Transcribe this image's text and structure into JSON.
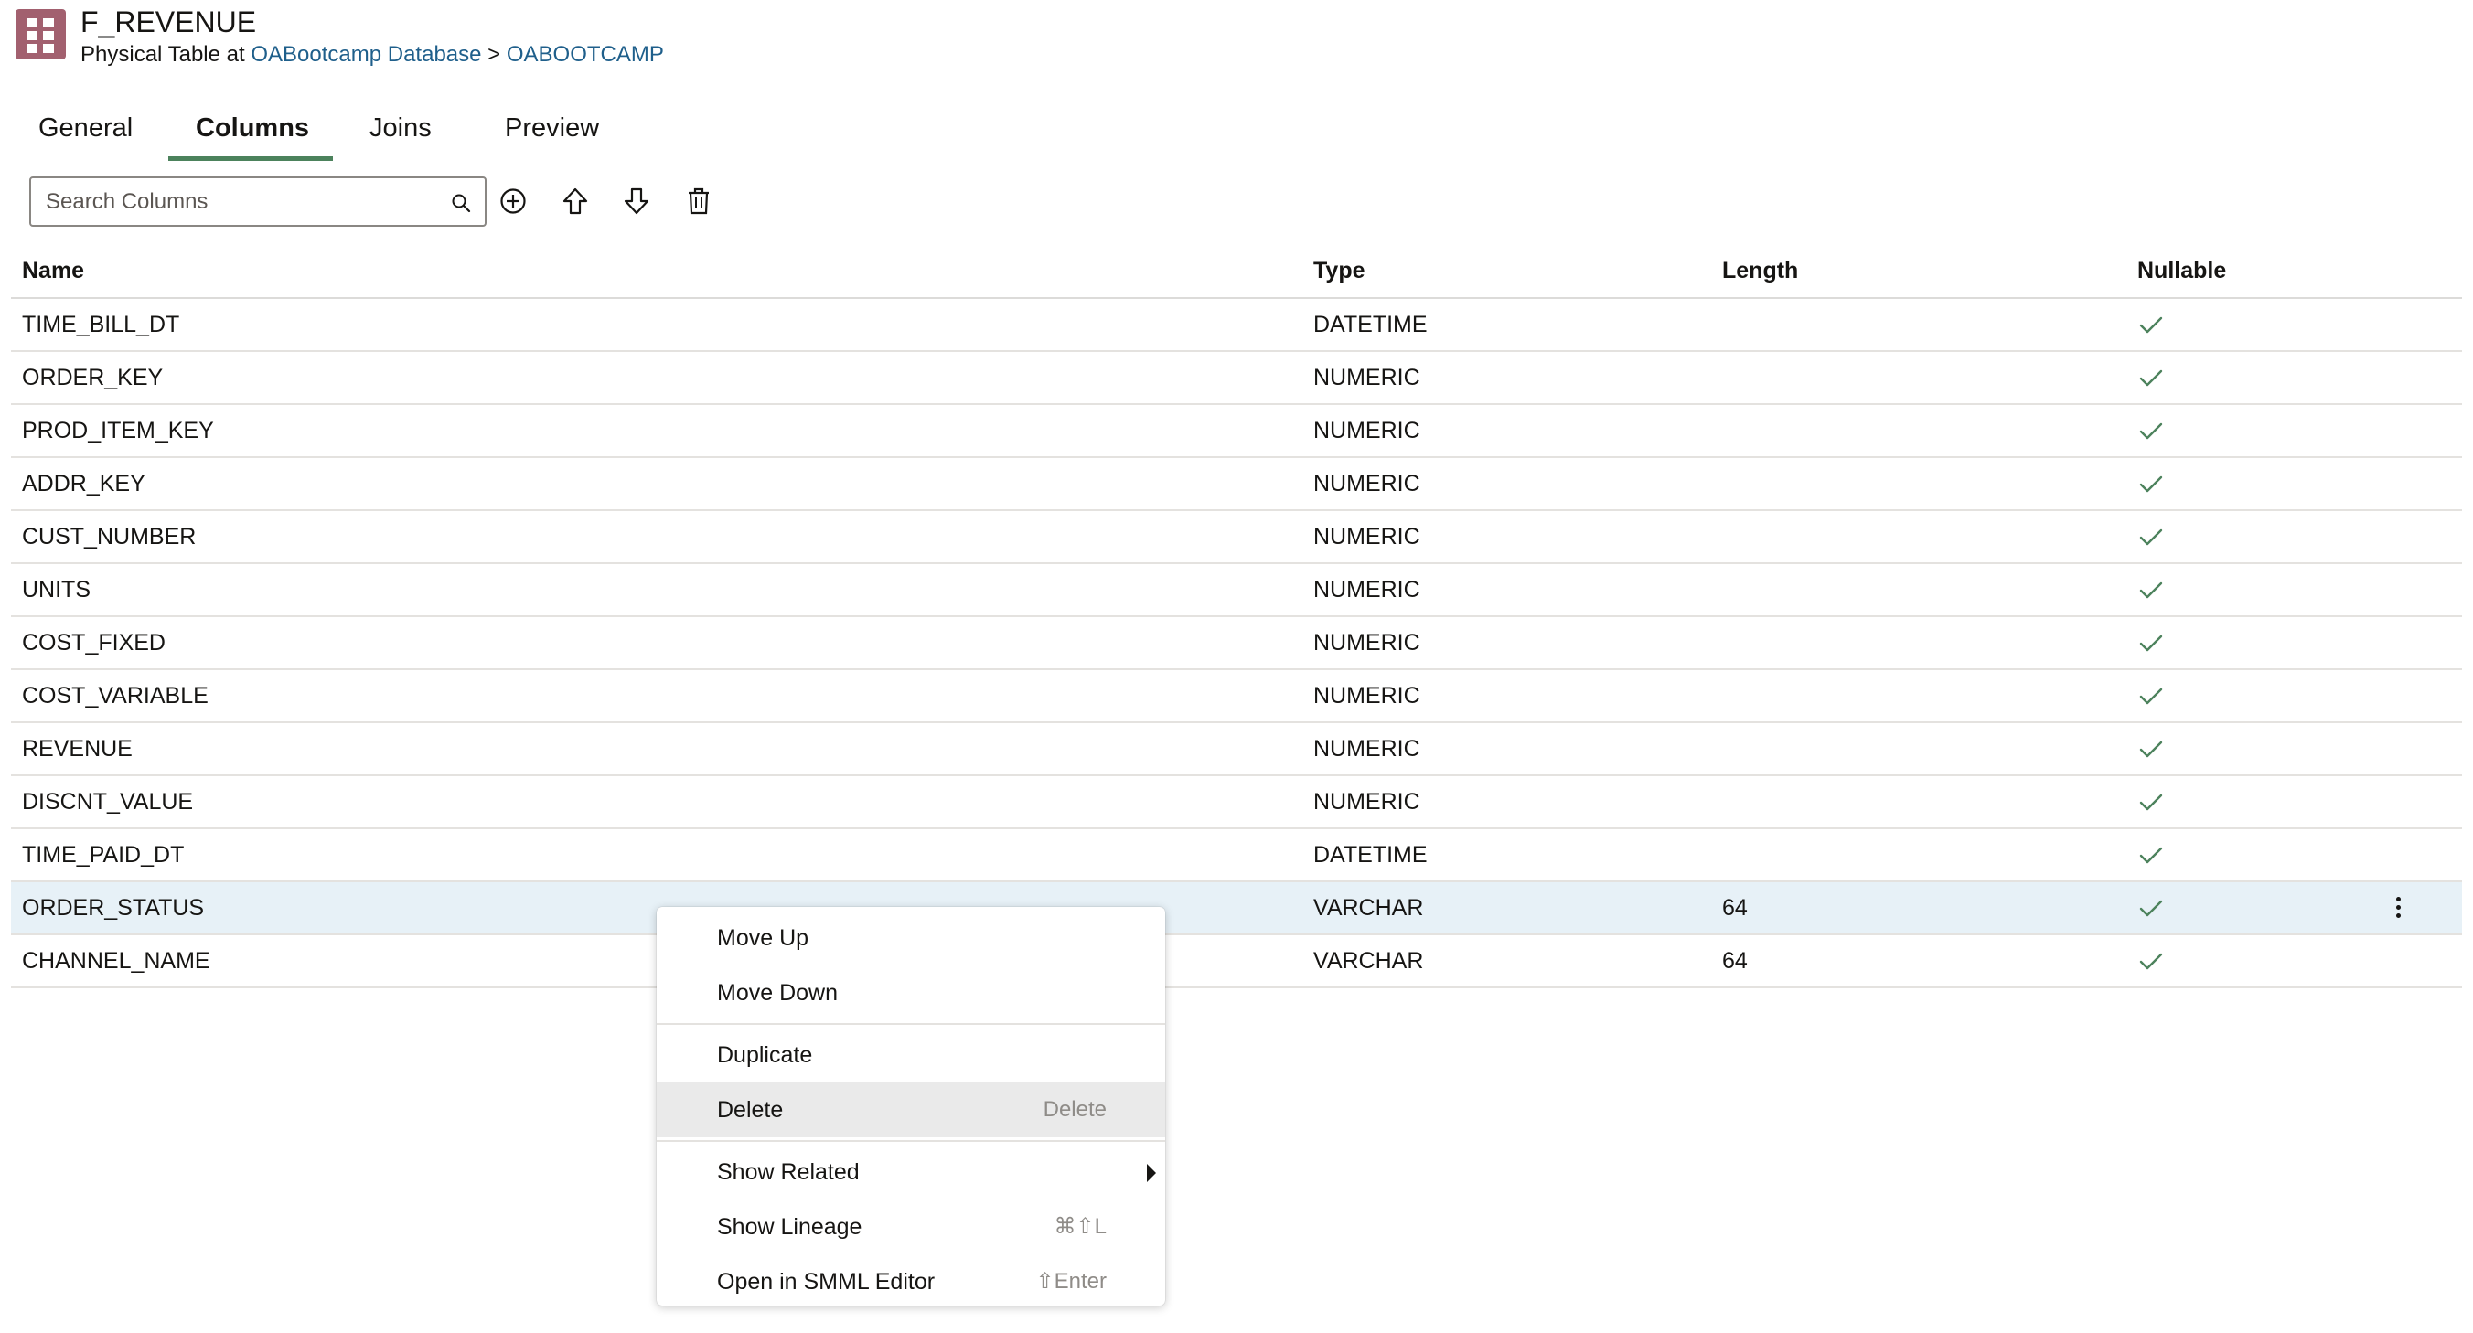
{
  "header": {
    "title": "F_REVENUE",
    "subtitle_prefix": "Physical Table at",
    "database_link": "OABootcamp Database",
    "separator": ">",
    "schema_link": "OABOOTCAMP",
    "icon": "table-grid-icon",
    "icon_color": "#a2606f"
  },
  "tabs": [
    {
      "label": "General"
    },
    {
      "label": "Columns",
      "active": true
    },
    {
      "label": "Joins"
    },
    {
      "label": "Preview"
    }
  ],
  "toolbar": {
    "search_placeholder": "Search Columns",
    "search_value": "",
    "icons": [
      "add-icon",
      "move-up-icon",
      "move-down-icon",
      "delete-icon"
    ]
  },
  "table": {
    "headers": {
      "name": "Name",
      "type": "Type",
      "length": "Length",
      "nullable": "Nullable"
    },
    "rows": [
      {
        "name": "TIME_BILL_DT",
        "type": "DATETIME",
        "length": "",
        "nullable": true
      },
      {
        "name": "ORDER_KEY",
        "type": "NUMERIC",
        "length": "",
        "nullable": true
      },
      {
        "name": "PROD_ITEM_KEY",
        "type": "NUMERIC",
        "length": "",
        "nullable": true
      },
      {
        "name": "ADDR_KEY",
        "type": "NUMERIC",
        "length": "",
        "nullable": true
      },
      {
        "name": "CUST_NUMBER",
        "type": "NUMERIC",
        "length": "",
        "nullable": true
      },
      {
        "name": "UNITS",
        "type": "NUMERIC",
        "length": "",
        "nullable": true
      },
      {
        "name": "COST_FIXED",
        "type": "NUMERIC",
        "length": "",
        "nullable": true
      },
      {
        "name": "COST_VARIABLE",
        "type": "NUMERIC",
        "length": "",
        "nullable": true
      },
      {
        "name": "REVENUE",
        "type": "NUMERIC",
        "length": "",
        "nullable": true
      },
      {
        "name": "DISCNT_VALUE",
        "type": "NUMERIC",
        "length": "",
        "nullable": true
      },
      {
        "name": "TIME_PAID_DT",
        "type": "DATETIME",
        "length": "",
        "nullable": true
      },
      {
        "name": "ORDER_STATUS",
        "type": "VARCHAR",
        "length": "64",
        "nullable": true,
        "selected": true
      },
      {
        "name": "CHANNEL_NAME",
        "type": "VARCHAR",
        "length": "64",
        "nullable": true
      }
    ],
    "selected_row_color": "#e7f1f7",
    "check_color": "#4c825c"
  },
  "context_menu": {
    "items": [
      {
        "label": "Move Up",
        "shortcut": ""
      },
      {
        "label": "Move Down",
        "shortcut": ""
      },
      {
        "separator": true
      },
      {
        "label": "Duplicate",
        "shortcut": ""
      },
      {
        "label": "Delete",
        "shortcut": "Delete",
        "highlighted": true
      },
      {
        "separator": true
      },
      {
        "label": "Show Related",
        "shortcut": "",
        "submenu": true
      },
      {
        "label": "Show Lineage",
        "shortcut": "⌘⇧L"
      },
      {
        "label": "Open in SMML Editor",
        "shortcut": "⇧Enter"
      }
    ]
  }
}
